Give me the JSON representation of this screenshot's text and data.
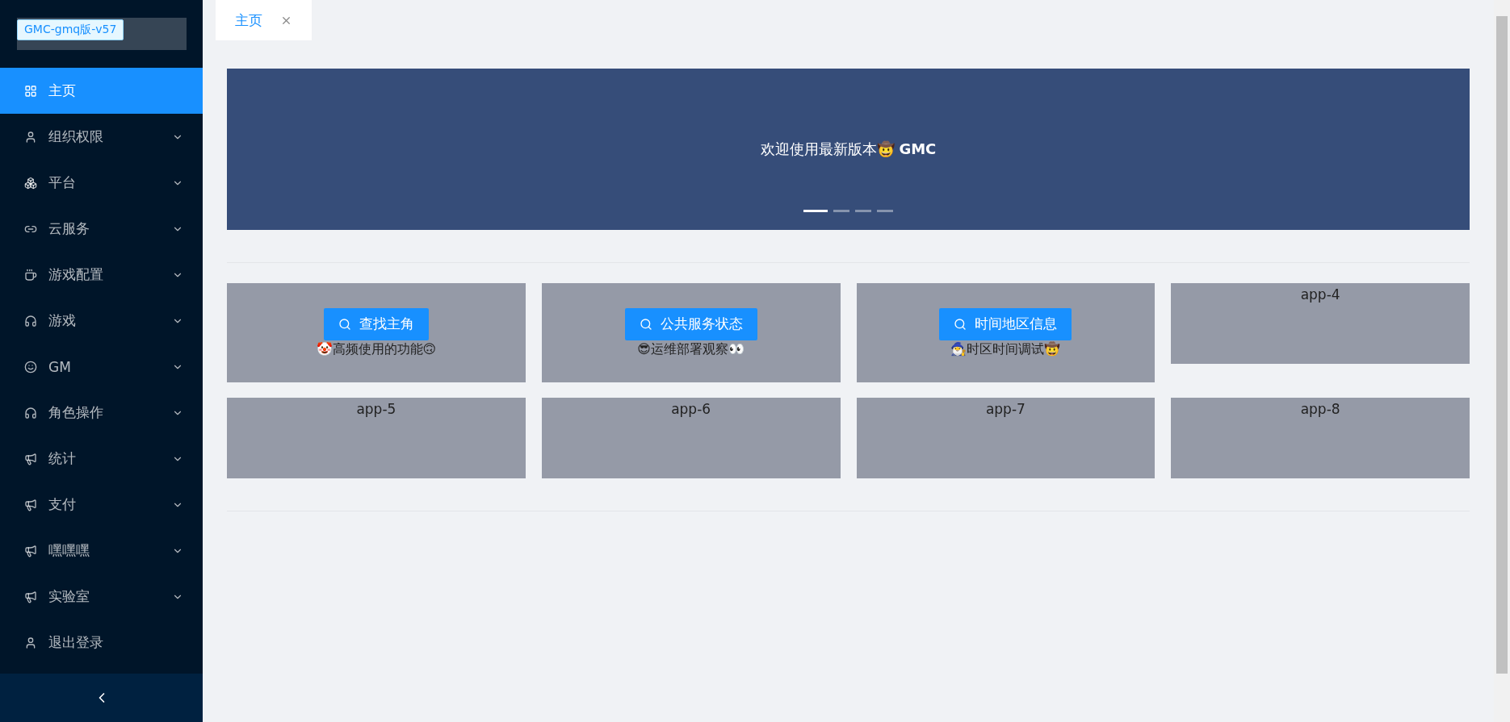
{
  "app_title": "GMC-gmq版-v57",
  "menu": [
    {
      "label": "主页",
      "selected": true,
      "expandable": false
    },
    {
      "label": "组织权限",
      "selected": false,
      "expandable": true
    },
    {
      "label": "平台",
      "selected": false,
      "expandable": true
    },
    {
      "label": "云服务",
      "selected": false,
      "expandable": true
    },
    {
      "label": "游戏配置",
      "selected": false,
      "expandable": true
    },
    {
      "label": "游戏",
      "selected": false,
      "expandable": true
    },
    {
      "label": "GM",
      "selected": false,
      "expandable": true
    },
    {
      "label": "角色操作",
      "selected": false,
      "expandable": true
    },
    {
      "label": "统计",
      "selected": false,
      "expandable": true
    },
    {
      "label": "支付",
      "selected": false,
      "expandable": true
    },
    {
      "label": "嘿嘿嘿",
      "selected": false,
      "expandable": true
    },
    {
      "label": "实验室",
      "selected": false,
      "expandable": true
    },
    {
      "label": "退出登录",
      "selected": false,
      "expandable": false
    }
  ],
  "tabs": [
    {
      "label": "主页",
      "selected": true
    }
  ],
  "banner": {
    "text": "欢迎使用最新版本🤠 **GMC**",
    "dots": [
      {
        "selected": true
      },
      {
        "selected": false
      },
      {
        "selected": false
      },
      {
        "selected": false
      }
    ]
  },
  "apps": [
    {
      "kind": "action",
      "button": "查找主角",
      "caption": "🤡高频使用的功能🙃"
    },
    {
      "kind": "action",
      "button": "公共服务状态",
      "caption": "😎运维部署观察👀"
    },
    {
      "kind": "action",
      "button": "时间地区信息",
      "caption": "🧙‍♂️时区时间调试🤠"
    },
    {
      "kind": "plain",
      "label": "app-4"
    },
    {
      "kind": "plain",
      "label": "app-5"
    },
    {
      "kind": "plain",
      "label": "app-6"
    },
    {
      "kind": "plain",
      "label": "app-7"
    },
    {
      "kind": "plain",
      "label": "app-8"
    }
  ]
}
